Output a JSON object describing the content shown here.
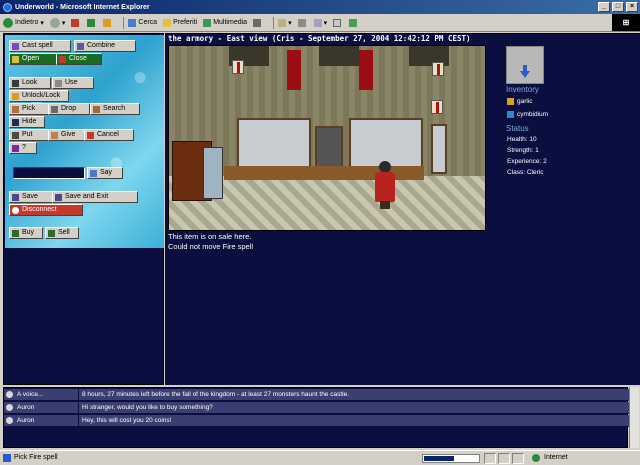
{
  "window": {
    "title": "Underworld - Microsoft Internet Explorer"
  },
  "toolbar": {
    "back": "Indietro",
    "search": "Cerca",
    "favorites": "Preferiti",
    "multimedia": "Multimedia"
  },
  "actions": {
    "cast_spell": "Cast spell",
    "combine": "Combine",
    "open": "Open",
    "close": "Close",
    "look": "Look",
    "use": "Use",
    "unlock_lock": "Unlock/Lock",
    "pick": "Pick",
    "drop": "Drop",
    "search": "Search",
    "hide": "Hide",
    "put": "Put",
    "give": "Give",
    "cancel": "Cancel",
    "help": "?",
    "say": "Say",
    "save": "Save",
    "save_exit": "Save and Exit",
    "disconnect": "Disconnect",
    "buy": "Buy",
    "sell": "Sell"
  },
  "scene": {
    "title": "the armory - East view (Cris - September 27, 2004 12:42:12 PM CEST)",
    "messages": [
      "This item is on sale here.",
      "Could not move Fire spell"
    ]
  },
  "inventory": {
    "heading": "Inventory",
    "items": [
      "garlic",
      "cymbidium"
    ]
  },
  "status": {
    "heading": "Status",
    "health": "Health: 10",
    "strength": "Strength: 1",
    "experience": "Experience: 2",
    "class": "Class: Cleric"
  },
  "chat": [
    {
      "speaker": "A voice...",
      "text": "8 hours, 27 minutes left before the fall of the kingdom - at least 27 monsters haunt the castle."
    },
    {
      "speaker": "Auron",
      "text": "Hi stranger, would you like to buy something?"
    },
    {
      "speaker": "Auron",
      "text": "Hey, this will cost you 20 coins!"
    }
  ],
  "statusbar": {
    "text": "Pick Fire spell",
    "zone": "Internet",
    "progress": 0.55
  },
  "colors": {
    "accent": "#0a246a",
    "panel": "#0b0f3f",
    "water": "#5fc9e8"
  }
}
